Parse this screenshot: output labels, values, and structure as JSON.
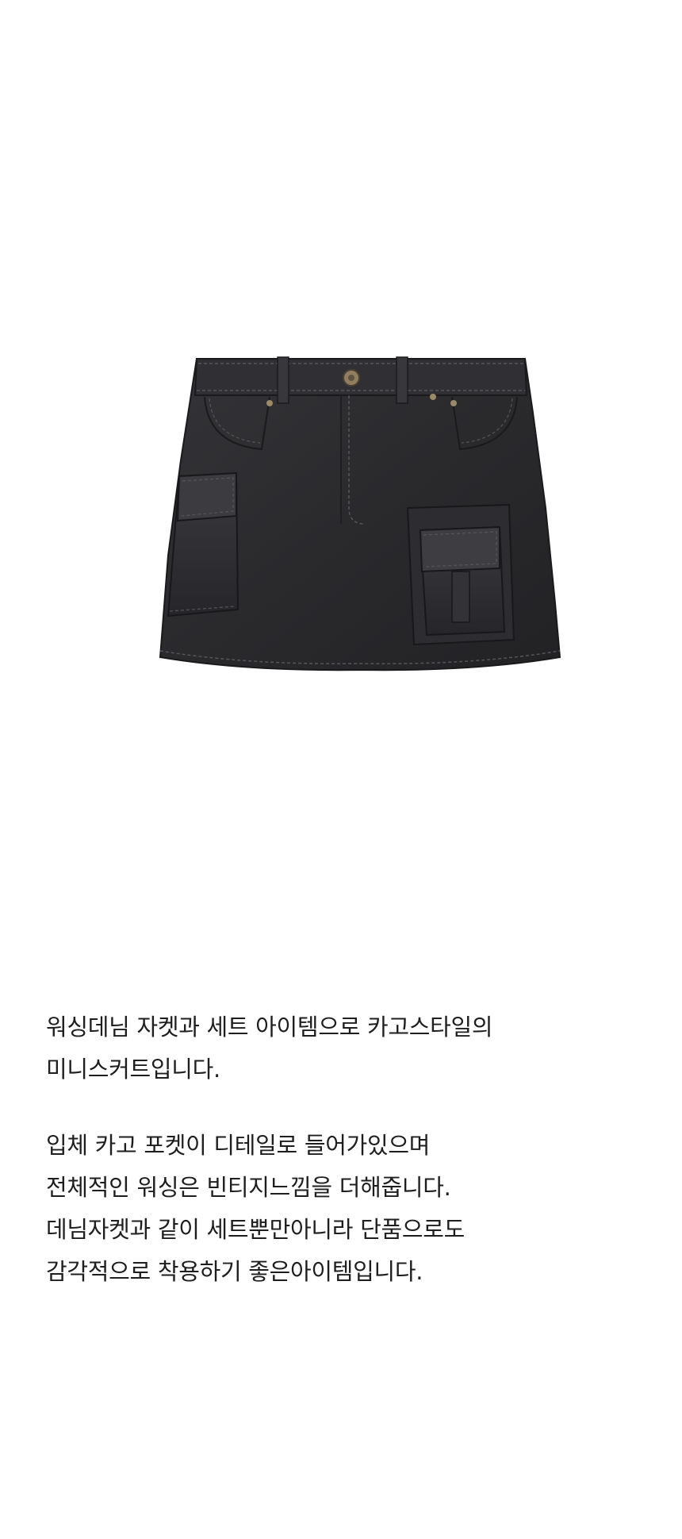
{
  "product": {
    "image_icon": "denim-cargo-mini-skirt-icon",
    "colors": {
      "denim": "#2b2b2e",
      "denim_shadow": "#1c1c1f",
      "denim_highlight": "#3a3a3e",
      "stitch": "#55555a",
      "rivet": "#9a8a6a",
      "background": "#ffffff",
      "text": "#1e1e1e"
    }
  },
  "description": {
    "paragraphs": [
      {
        "lines": [
          "워싱데님 자켓과 세트 아이템으로 카고스타일의",
          "미니스커트입니다."
        ]
      },
      {
        "lines": [
          "입체 카고 포켓이 디테일로 들어가있으며",
          "전체적인 워싱은 빈티지느낌을 더해줍니다.",
          "데님자켓과 같이 세트뿐만아니라 단품으로도",
          "감각적으로 착용하기 좋은아이템입니다."
        ]
      }
    ]
  }
}
